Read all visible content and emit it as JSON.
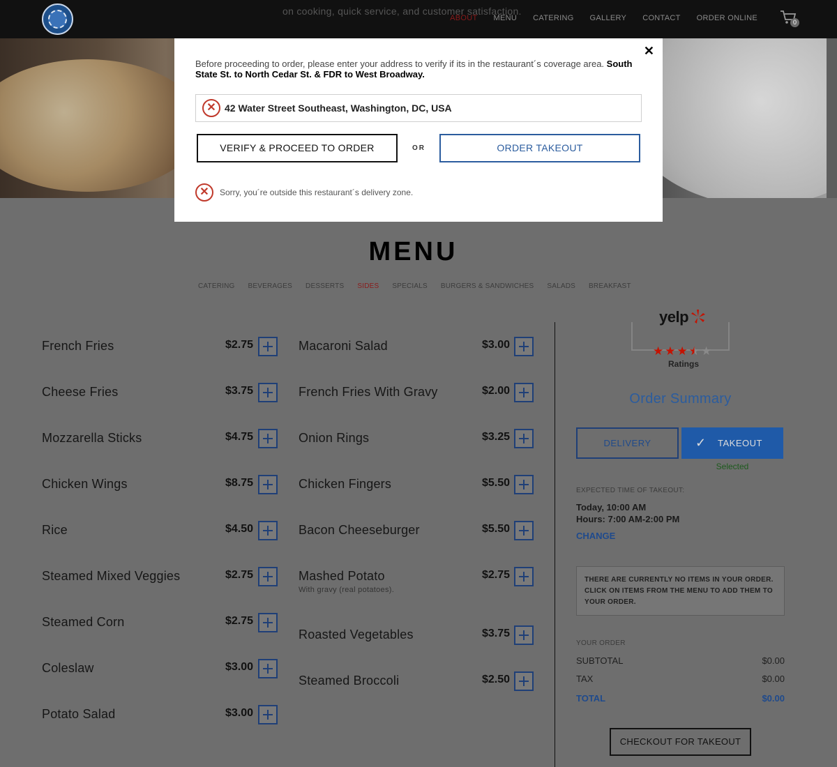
{
  "header": {
    "tagline": "on cooking, quick service, and customer satisfaction.",
    "nav": [
      "ABOUT",
      "MENU",
      "CATERING",
      "GALLERY",
      "CONTACT",
      "ORDER ONLINE"
    ],
    "active_nav": "ABOUT",
    "cart_count": "0"
  },
  "modal": {
    "message": "Before proceeding to order, please enter your address to verify if its in the restaurant´s coverage area.",
    "coverage": "South State St. to North Cedar St. & FDR to West Broadway.",
    "address": "42 Water Street Southeast, Washington, DC, USA",
    "verify_label": "VERIFY & PROCEED TO ORDER",
    "or_label": "OR",
    "takeout_label": "ORDER TAKEOUT",
    "error": "Sorry, you´re outside this restaurant´s delivery zone.",
    "close_glyph": "✕"
  },
  "menu": {
    "title": "MENU",
    "categories": [
      "CATERING",
      "BEVERAGES",
      "DESSERTS",
      "SIDES",
      "SPECIALS",
      "BURGERS & SANDWICHES",
      "SALADS",
      "BREAKFAST"
    ],
    "active_category": "SIDES",
    "col1": [
      {
        "name": "French Fries",
        "price": "$2.75"
      },
      {
        "name": "Cheese Fries",
        "price": "$3.75"
      },
      {
        "name": "Mozzarella Sticks",
        "price": "$4.75"
      },
      {
        "name": "Chicken Wings",
        "price": "$8.75"
      },
      {
        "name": "Rice",
        "price": "$4.50"
      },
      {
        "name": "Steamed Mixed Veggies",
        "price": "$2.75"
      },
      {
        "name": "Steamed Corn",
        "price": "$2.75"
      },
      {
        "name": "Coleslaw",
        "price": "$3.00"
      },
      {
        "name": "Potato Salad",
        "price": "$3.00"
      }
    ],
    "col2": [
      {
        "name": "Macaroni Salad",
        "price": "$3.00"
      },
      {
        "name": "French Fries With Gravy",
        "price": "$2.00"
      },
      {
        "name": "Onion Rings",
        "price": "$3.25"
      },
      {
        "name": "Chicken Fingers",
        "price": "$5.50"
      },
      {
        "name": "Bacon Cheeseburger",
        "price": "$5.50"
      },
      {
        "name": "Mashed Potato",
        "price": "$2.75",
        "desc": "With gravy (real potatoes)."
      },
      {
        "name": "Roasted Vegetables",
        "price": "$3.75"
      },
      {
        "name": "Steamed Broccoli",
        "price": "$2.50"
      }
    ]
  },
  "sidebar": {
    "yelp": {
      "logo": "yelp",
      "rating": 3.5,
      "max": 5,
      "label": "Ratings"
    },
    "order_summary_title": "Order Summary",
    "delivery_label": "DELIVERY",
    "takeout_label": "TAKEOUT",
    "selected_label": "Selected",
    "expected_label": "EXPECTED TIME OF TAKEOUT:",
    "expected_time": "Today, 10:00 AM",
    "hours": "Hours: 7:00 AM-2:00 PM",
    "change_label": "CHANGE",
    "empty_message": "THERE ARE CURRENTLY NO ITEMS IN YOUR ORDER. CLICK ON ITEMS FROM THE MENU TO ADD THEM TO YOUR ORDER.",
    "your_order_label": "YOUR ORDER",
    "subtotal_label": "SUBTOTAL",
    "subtotal": "$0.00",
    "tax_label": "TAX",
    "tax": "$0.00",
    "total_label": "TOTAL",
    "total": "$0.00",
    "checkout_label": "CHECKOUT FOR TAKEOUT"
  },
  "colors": {
    "accent": "#2b5c9e",
    "error": "#c0392b",
    "active_red": "#8a1b1b",
    "yelp_red": "#c41200"
  }
}
